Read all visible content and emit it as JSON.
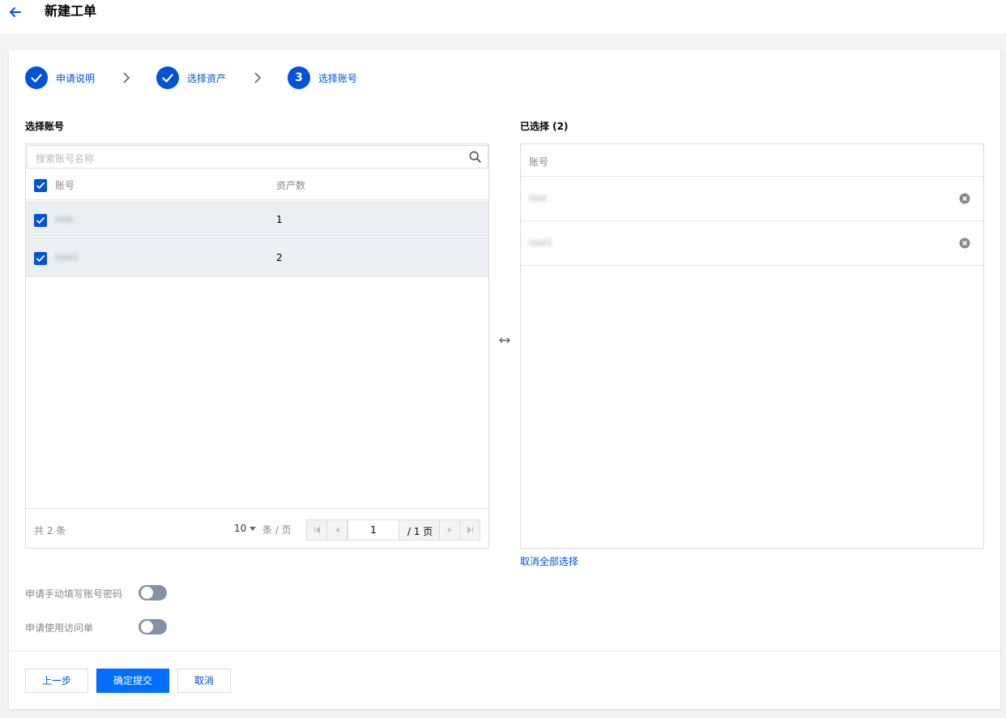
{
  "header": {
    "title": "新建工单"
  },
  "steps": [
    {
      "label": "申请说明",
      "state": "done"
    },
    {
      "label": "选择资产",
      "state": "done"
    },
    {
      "label": "选择账号",
      "state": "active",
      "number": "3"
    }
  ],
  "left": {
    "title": "选择账号",
    "search_placeholder": "搜索账号名称",
    "columns": [
      "账号",
      "资产数"
    ],
    "rows": [
      {
        "account": "root",
        "assets": "1",
        "checked": true
      },
      {
        "account": "root1",
        "assets": "2",
        "checked": true
      }
    ],
    "footer": {
      "total": "共 2 条",
      "page_size": "10",
      "per_page": "条 / 页",
      "current_page": "1",
      "total_pages": "/ 1 页"
    }
  },
  "right": {
    "title": "已选择 (2)",
    "column": "账号",
    "items": [
      "root",
      "root1"
    ],
    "clear_all": "取消全部选择"
  },
  "options": [
    {
      "label": "申请手动填写账号密码",
      "enabled": false
    },
    {
      "label": "申请使用访问单",
      "enabled": false
    }
  ],
  "buttons": {
    "prev": "上一步",
    "submit": "确定提交",
    "cancel": "取消"
  },
  "colors": {
    "primary": "#0052d9",
    "submit": "#006eff",
    "toggle_off": "#8592a6"
  }
}
